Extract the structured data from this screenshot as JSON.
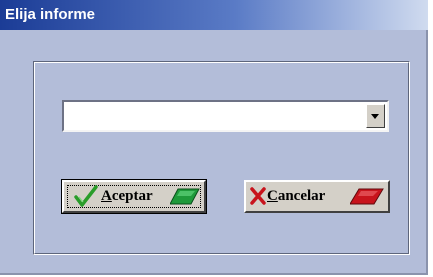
{
  "window": {
    "title": "Elija informe"
  },
  "report_select": {
    "value": ""
  },
  "buttons": {
    "accept": {
      "mnemonic": "A",
      "rest": "ceptar"
    },
    "cancel": {
      "mnemonic": "C",
      "rest": "ancelar"
    }
  },
  "icons": {
    "check": "check-icon",
    "cross": "cross-icon",
    "green_shape": "green-parallelogram-icon",
    "red_shape": "red-parallelogram-icon"
  },
  "colors": {
    "titlebar_start": "#1b3c96",
    "dialog_bg": "#b3bdd9",
    "check": "#2a9d2a",
    "cross": "#c8141c"
  }
}
